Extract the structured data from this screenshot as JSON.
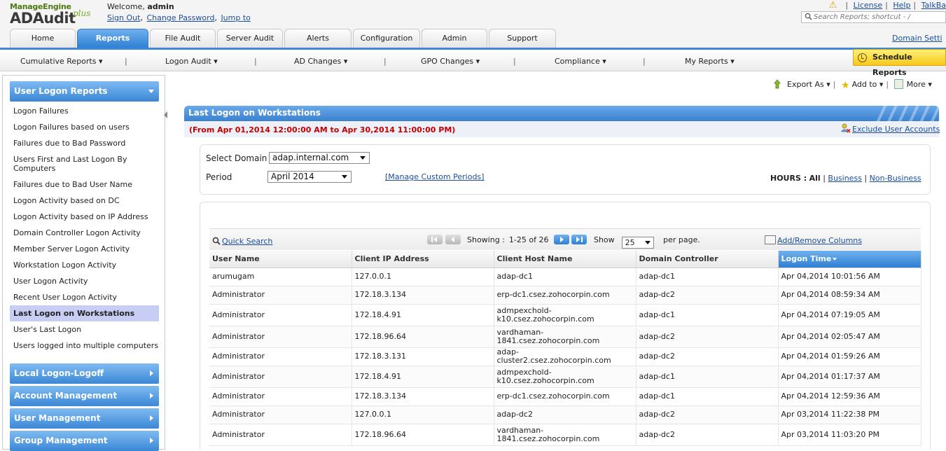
{
  "header": {
    "logo_brand": "ManageEngine",
    "logo_product": "ADAudit",
    "logo_plus": "plus",
    "welcome_prefix": "Welcome,",
    "username": "admin",
    "links": [
      "Sign Out",
      "Change Password",
      "Jump to"
    ],
    "top_links": [
      "License",
      "Help",
      "TalkBa"
    ],
    "search_placeholder": "Search Reports; shortcut - /",
    "domain_settings": "Domain Setti"
  },
  "tabs": [
    {
      "label": "Home",
      "active": false
    },
    {
      "label": "Reports",
      "active": true
    },
    {
      "label": "File Audit",
      "active": false
    },
    {
      "label": "Server Audit",
      "active": false
    },
    {
      "label": "Alerts",
      "active": false
    },
    {
      "label": "Configuration",
      "active": false
    },
    {
      "label": "Admin",
      "active": false
    },
    {
      "label": "Support",
      "active": false
    }
  ],
  "subnav": {
    "items": [
      "Cumulative Reports ▾",
      "Logon Audit ▾",
      "AD Changes ▾",
      "GPO Changes ▾",
      "Compliance ▾",
      "My Reports ▾"
    ],
    "schedule_reports": "Schedule Reports"
  },
  "sidebar": {
    "section_open": "User Logon Reports",
    "items": [
      "Logon Failures",
      "Logon Failures based on users",
      "Failures due to Bad Password",
      "Users First and Last Logon By Computers",
      "Failures due to Bad User Name",
      "Logon Activity based on DC",
      "Logon Activity based on IP Address",
      "Domain Controller Logon Activity",
      "Member Server Logon Activity",
      "Workstation Logon Activity",
      "User Logon Activity",
      "Recent User Logon Activity",
      "Last Logon on Workstations",
      "User's Last Logon",
      "Users logged into multiple computers"
    ],
    "selected": "Last Logon on Workstations",
    "sections_closed": [
      "Local Logon-Logoff",
      "Account Management",
      "User Management",
      "Group Management"
    ]
  },
  "actions": {
    "export": "Export As ▾",
    "add_to": "Add to ▾",
    "more": "More ▾"
  },
  "report": {
    "title": "Last Logon on Workstations",
    "date_range": "(From Apr 01,2014 12:00:00 AM to Apr 30,2014 11:00:00 PM)",
    "exclude_link": "Exclude User Accounts",
    "select_domain_label": "Select Domain",
    "domain_value": "adap.internal.com",
    "period_label": "Period",
    "period_value": "April 2014",
    "manage_periods": "[Manage Custom Periods]",
    "hours_label": "HOURS :",
    "hours_all": "All",
    "hours_business": "Business",
    "hours_nonbusiness": "Non-Business"
  },
  "grid": {
    "quick_search": "Quick Search",
    "showing_label": "Showing :",
    "range": "1-25 of 26",
    "show_label": "Show",
    "per_page_value": "25",
    "per_page_label": "per page.",
    "add_remove_columns": "Add/Remove Columns",
    "columns": [
      "User Name",
      "Client IP Address",
      "Client Host Name",
      "Domain Controller",
      "Logon Time"
    ],
    "sorted_column": "Logon Time",
    "rows": [
      [
        "arumugam",
        "127.0.0.1",
        "adap-dc1",
        "adap-dc1",
        "Apr 04,2014 10:01:56 AM"
      ],
      [
        "Administrator",
        "172.18.3.134",
        "erp-dc1.csez.zohocorpin.com",
        "adap-dc2",
        "Apr 04,2014 08:59:34 AM"
      ],
      [
        "Administrator",
        "172.18.4.91",
        "admpexchold-k10.csez.zohocorpin.com",
        "adap-dc1",
        "Apr 04,2014 07:19:05 AM"
      ],
      [
        "Administrator",
        "172.18.96.64",
        "vardhaman-1841.csez.zohocorpin.com",
        "adap-dc2",
        "Apr 04,2014 02:05:47 AM"
      ],
      [
        "Administrator",
        "172.18.3.131",
        "adap-cluster2.csez.zohocorpin.com",
        "adap-dc2",
        "Apr 04,2014 01:59:26 AM"
      ],
      [
        "Administrator",
        "172.18.4.91",
        "admpexchold-k10.csez.zohocorpin.com",
        "adap-dc1",
        "Apr 04,2014 01:17:37 AM"
      ],
      [
        "Administrator",
        "172.18.3.134",
        "erp-dc1.csez.zohocorpin.com",
        "adap-dc1",
        "Apr 04,2014 12:59:36 AM"
      ],
      [
        "Administrator",
        "127.0.0.1",
        "adap-dc2",
        "adap-dc2",
        "Apr 03,2014 11:22:38 PM"
      ],
      [
        "Administrator",
        "172.18.96.64",
        "vardhaman-1841.csez.zohocorpin.com",
        "adap-dc2",
        "Apr 03,2014 11:03:20 PM"
      ]
    ]
  },
  "colors": {
    "accent_blue": "#3a87d6",
    "date_red": "#c40000",
    "selected_item": "#c8cdf3",
    "schedule_yellow": "#f6c81b"
  }
}
